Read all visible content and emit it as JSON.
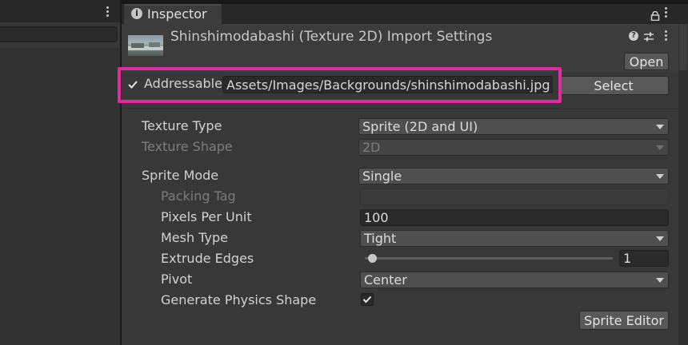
{
  "inspector": {
    "tab_label": "Inspector",
    "header_title": "Shinshimodabashi (Texture 2D) Import Settings",
    "open_label": "Open",
    "icons": {
      "tab": "info-icon",
      "lock": "lock-icon",
      "menu": "kebab-menu-icon",
      "help": "help-icon",
      "presets": "settings-sliders-icon"
    }
  },
  "addressable": {
    "label": "Addressable",
    "checked": true,
    "path": "Assets/Images/Backgrounds/shinshimodabashi.jpg",
    "select_label": "Select",
    "highlight_color": "#e5299f"
  },
  "properties": {
    "texture_type": {
      "label": "Texture Type",
      "value": "Sprite (2D and UI)"
    },
    "texture_shape": {
      "label": "Texture Shape",
      "value": "2D"
    },
    "sprite_mode": {
      "label": "Sprite Mode",
      "value": "Single"
    },
    "packing_tag": {
      "label": "Packing Tag",
      "value": ""
    },
    "pixels_per_unit": {
      "label": "Pixels Per Unit",
      "value": "100"
    },
    "mesh_type": {
      "label": "Mesh Type",
      "value": "Tight"
    },
    "extrude_edges": {
      "label": "Extrude Edges",
      "value": "1",
      "slider_fraction": 0.03
    },
    "pivot": {
      "label": "Pivot",
      "value": "Center"
    },
    "generate_physics_shape": {
      "label": "Generate Physics Shape",
      "checked": true
    },
    "sprite_editor_label": "Sprite Editor"
  },
  "colors": {
    "panel_bg": "#383838",
    "header_bg": "#3c3c3c",
    "field_bg": "#2a2a2a",
    "dropdown_bg": "#4f4f4f",
    "text": "#d2d2d2",
    "dim_text": "#7c7c7c"
  }
}
